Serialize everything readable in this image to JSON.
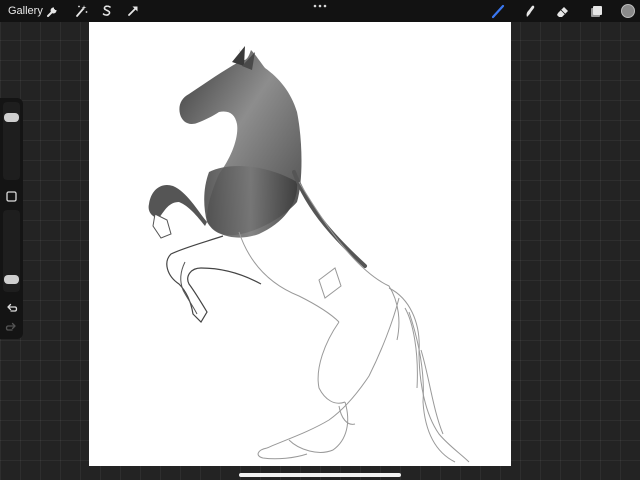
{
  "topbar": {
    "gallery_label": "Gallery",
    "left_tools": [
      "wrench-icon",
      "magic-wand-icon",
      "selection-icon",
      "transform-arrow-icon"
    ],
    "more_icon": "ellipsis-icon",
    "right_tools": [
      "brush-icon",
      "smudge-icon",
      "eraser-icon",
      "layers-icon",
      "color-swatch-icon"
    ]
  },
  "tools": {
    "active_tool": "brush",
    "active_color": "#3a78f2",
    "current_color_swatch": "#8a8a8a"
  },
  "sidebar": {
    "brush_size_level": 0.85,
    "opacity_level": 0.1,
    "modify_button_icon": "square-icon",
    "undo_icon": "undo-icon",
    "redo_icon": "redo-icon"
  },
  "canvas": {
    "background": "#ffffff",
    "artwork": "horse-sketch"
  }
}
